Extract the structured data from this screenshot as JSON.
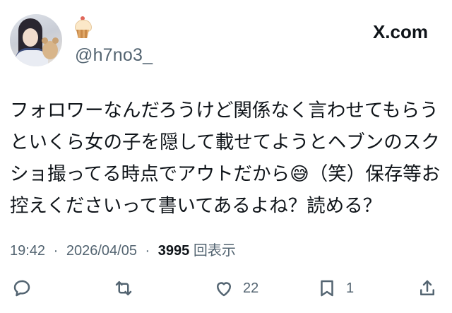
{
  "user": {
    "handle": "@h7no3_",
    "avatar_icon": "profile-photo",
    "badge_icon": "cupcake-emoji"
  },
  "brand": {
    "logo_text": "X.com"
  },
  "tweet": {
    "text": "フォロワーなんだろうけど関係なく言わせてもらうといくら女の子を隠して載せてようとヘブンのスクショ撮ってる時点でアウトだから😅（笑）保存等お控えくださいって書いてあるよね？読める？"
  },
  "meta": {
    "time": "19:42",
    "date": "2026/04/05",
    "separator": "·",
    "views_count": "3995",
    "views_label": "回表示"
  },
  "actions": {
    "reply": {
      "icon": "reply-icon",
      "count": ""
    },
    "retweet": {
      "icon": "retweet-icon",
      "count": ""
    },
    "like": {
      "icon": "heart-icon",
      "count": "22"
    },
    "bookmark": {
      "icon": "bookmark-icon",
      "count": "1"
    },
    "share": {
      "icon": "share-icon",
      "count": ""
    }
  },
  "colors": {
    "text_primary": "#0f1419",
    "text_secondary": "#536471",
    "background": "#ffffff"
  }
}
